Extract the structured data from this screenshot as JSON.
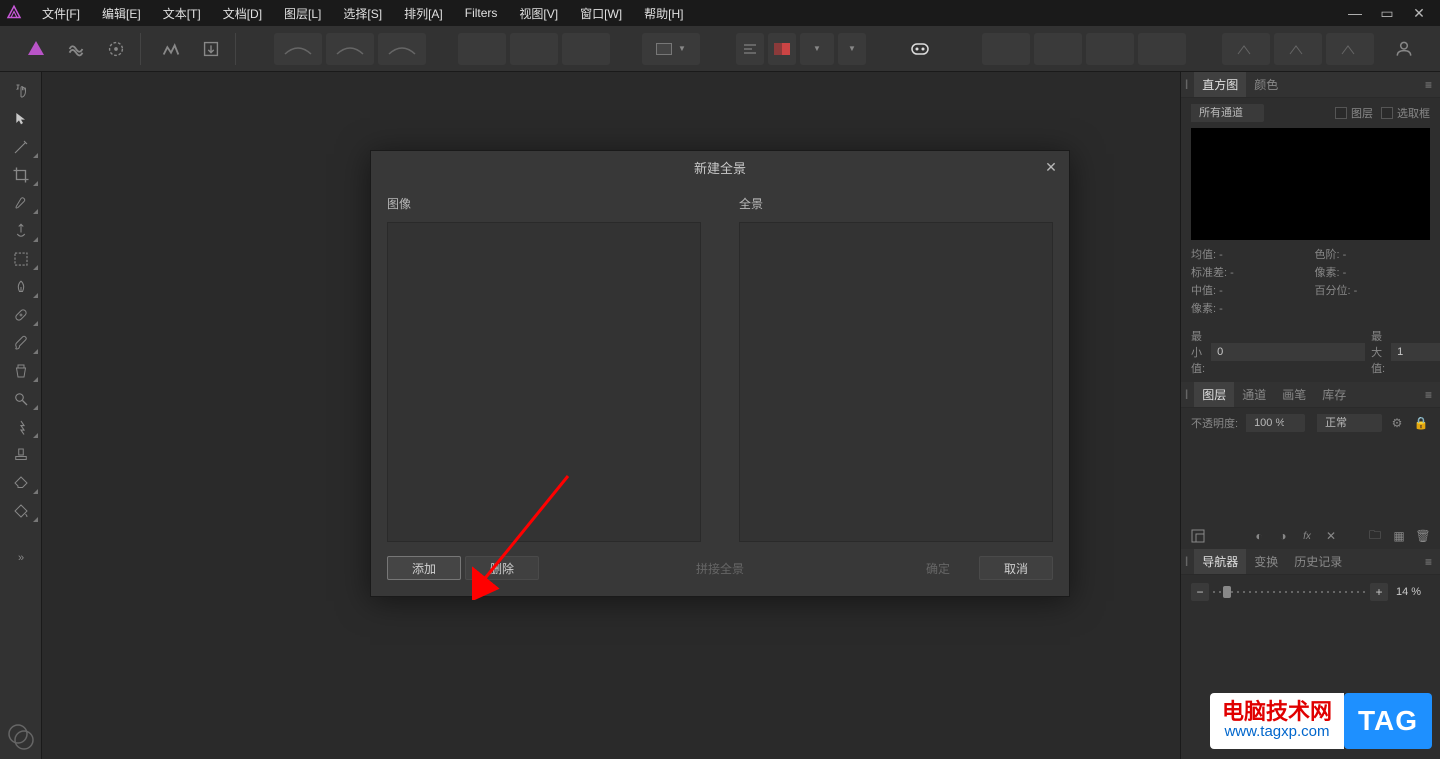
{
  "menu": {
    "items": [
      "文件[F]",
      "编辑[E]",
      "文本[T]",
      "文档[D]",
      "图层[L]",
      "选择[S]",
      "排列[A]",
      "Filters",
      "视图[V]",
      "窗口[W]",
      "帮助[H]"
    ]
  },
  "dialog": {
    "title": "新建全景",
    "left_label": "图像",
    "right_label": "全景",
    "add_btn": "添加",
    "delete_btn": "删除",
    "stitch_btn": "拼接全景",
    "ok_btn": "确定",
    "cancel_btn": "取消"
  },
  "panels": {
    "hist": {
      "tab1": "直方图",
      "tab2": "颜色",
      "channel": "所有通道",
      "chk_layer": "图层",
      "chk_sel": "选取框",
      "stat_mean": "均值:",
      "stat_mean_v": "-",
      "stat_std": "标准差:",
      "stat_std_v": "-",
      "stat_median": "中值:",
      "stat_median_v": "-",
      "stat_levels": "色阶:",
      "stat_levels_v": "-",
      "stat_pixels": "像素:",
      "stat_pixels_v": "-",
      "stat_percent": "百分位:",
      "stat_percent_v": "-",
      "min_label": "最小值:",
      "min_v": "0",
      "max_label": "最大值:",
      "max_v": "1"
    },
    "layers": {
      "tab1": "图层",
      "tab2": "通道",
      "tab3": "画笔",
      "tab4": "库存",
      "opacity_label": "不透明度:",
      "opacity_val": "100 %",
      "blend": "正常"
    },
    "nav": {
      "tab1": "导航器",
      "tab2": "变换",
      "tab3": "历史记录",
      "zoom": "14 %"
    }
  },
  "watermark": {
    "line1": "电脑技术网",
    "line2": "www.tagxp.com",
    "tag": "TAG"
  }
}
